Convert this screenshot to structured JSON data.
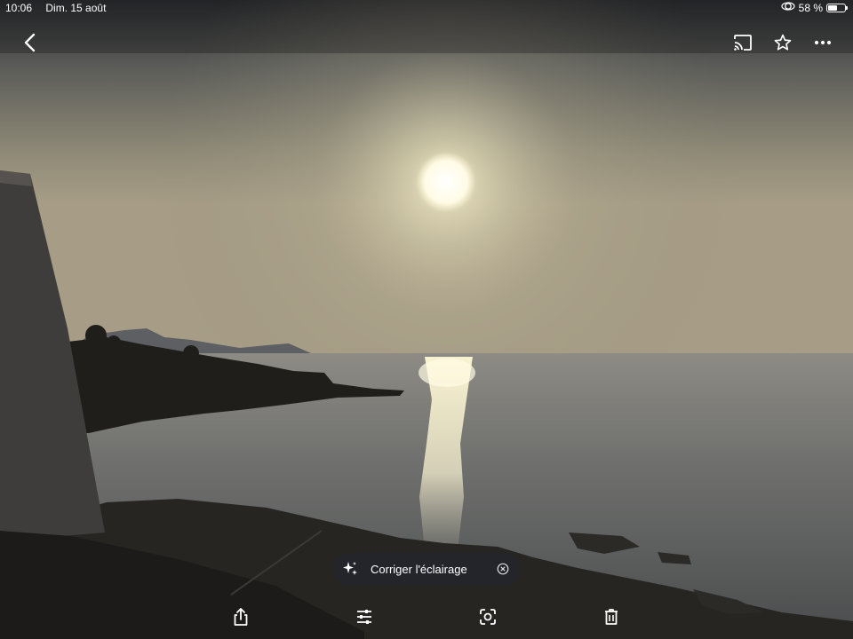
{
  "status": {
    "time": "10:06",
    "date": "Dim. 15 août",
    "battery": "58 %",
    "battery_level": 0.58
  },
  "top_bar": {
    "back_icon": "chevron-left-icon",
    "cast_icon": "cast-icon",
    "star_icon": "star-outline-icon",
    "more_icon": "more-horizontal-icon"
  },
  "suggestion": {
    "label": "Corriger l'éclairage",
    "icon": "sparkle-icon",
    "dismiss_icon": "close-circle-icon"
  },
  "bottom_toolbar": {
    "share_icon": "share-icon",
    "edit_icon": "sliders-icon",
    "lens_icon": "lens-icon",
    "delete_icon": "trash-icon"
  },
  "colors": {
    "chip_background": "#23262c",
    "icon": "#ffffff"
  }
}
